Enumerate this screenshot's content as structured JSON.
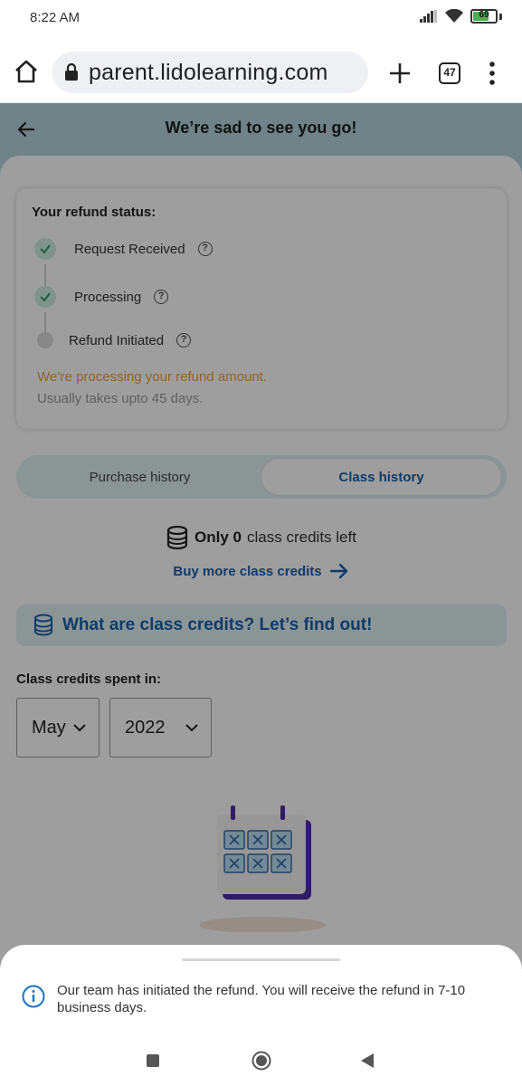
{
  "status_bar": {
    "time": "8:22 AM",
    "battery": "69",
    "battery_level": 0.69
  },
  "browser": {
    "url": "parent.lidolearning.com",
    "tab_count": "47"
  },
  "header": {
    "title": "We’re sad to see you go!"
  },
  "refund": {
    "title": "Your refund status:",
    "steps": [
      {
        "label": "Request Received",
        "state": "done"
      },
      {
        "label": "Processing",
        "state": "done"
      },
      {
        "label": "Refund Initiated",
        "state": "pending"
      }
    ],
    "message": "We’re processing your refund amount.",
    "sub_message": "Usually takes upto 45 days."
  },
  "tabs": {
    "purchase": "Purchase history",
    "class": "Class history",
    "active": "class"
  },
  "credits": {
    "prefix": "Only 0",
    "suffix": "class credits left",
    "buy_more": "Buy more class credits"
  },
  "banner": {
    "text": "What are class credits? Let’s find out!"
  },
  "spent": {
    "label": "Class credits spent in:",
    "month": "May",
    "year": "2022"
  },
  "toast": {
    "message": "Our team has initiated the refund. You will receive the refund in 7-10 business days."
  },
  "colors": {
    "accent_blue": "#1a5fa6",
    "header_bg": "#b4d4db",
    "warning": "#e8a13a",
    "success": "#3aa67a"
  }
}
